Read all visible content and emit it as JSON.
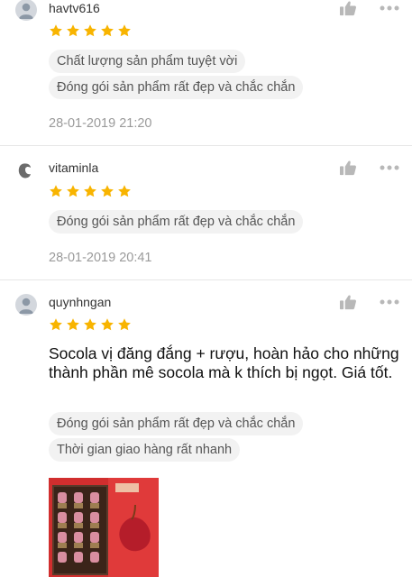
{
  "reviews": [
    {
      "username": "havtv616",
      "rating": 5,
      "tags": [
        "Chất lượng sản phẩm tuyệt vời",
        "Đóng gói sản phẩm rất đẹp và chắc chắn"
      ],
      "timestamp": "28-01-2019 21:20"
    },
    {
      "username": "vitaminla",
      "rating": 5,
      "tags": [
        "Đóng gói sản phẩm rất đẹp và chắc chắn"
      ],
      "timestamp": "28-01-2019 20:41"
    },
    {
      "username": "quynhngan",
      "rating": 5,
      "comment": "Socola vị đăng đắng + rượu, hoàn hảo cho những thành phần mê socola mà k thích bị ngọt. Giá tốt.",
      "tags": [
        "Đóng gói sản phẩm rất đẹp và chắc chắn",
        "Thời gian giao hàng rất nhanh"
      ]
    }
  ],
  "icons": {
    "like": "thumbs-up-icon",
    "more": "more-dots-icon",
    "star": "star-icon",
    "avatar": "default-avatar-icon"
  },
  "colors": {
    "star": "#f8b400",
    "icon_grey": "#b8b8b8",
    "tag_bg": "#f2f2f2",
    "timestamp": "#9a9a9a"
  }
}
